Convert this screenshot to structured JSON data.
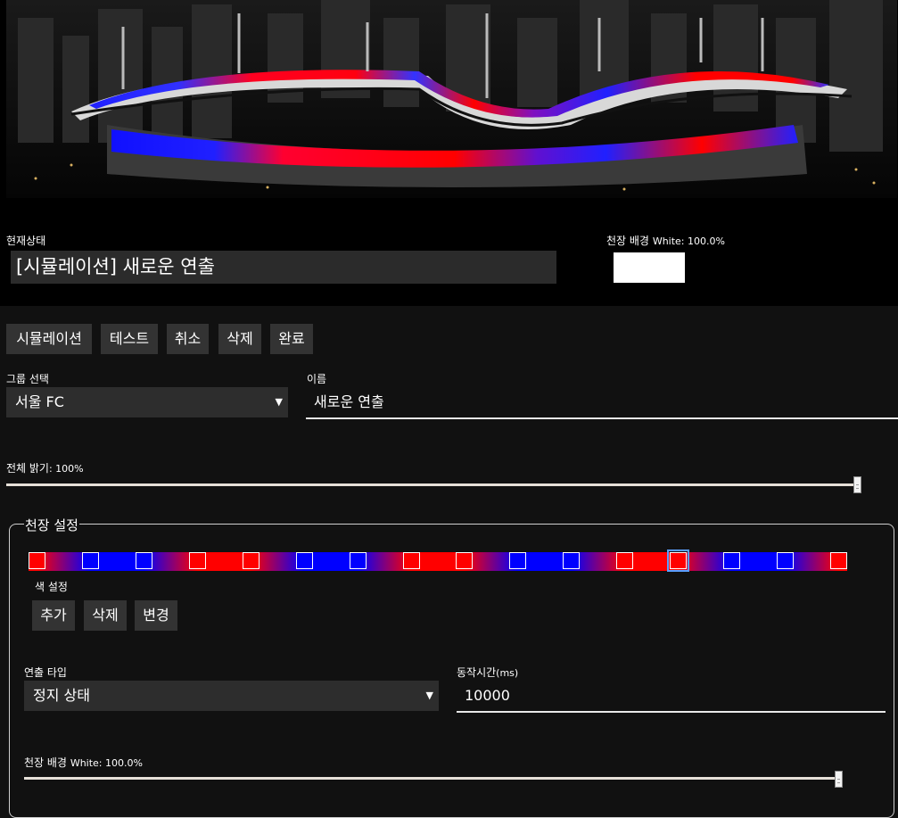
{
  "status": {
    "label": "현재상태",
    "value": "[시뮬레이션] 새로운 연출",
    "ceiling_label": "천장 배경",
    "ceiling_value": "White: 100.0%",
    "ceiling_color": "#ffffff"
  },
  "toolbar": {
    "simulate": "시뮬레이션",
    "test": "테스트",
    "cancel": "취소",
    "delete": "삭제",
    "done": "완료"
  },
  "group": {
    "label": "그룹 선택",
    "value": "서울 FC"
  },
  "name": {
    "label": "이름",
    "value": "새로운 연출"
  },
  "brightness": {
    "label": "전체 밝기",
    "value_text": ": 100%",
    "level": 1.0
  },
  "ceiling_settings": {
    "legend": "천장 설정",
    "stops": [
      "#ff0000",
      "#0000ff",
      "#0000ff",
      "#ff0000",
      "#ff0000",
      "#0000ff",
      "#0000ff",
      "#ff0000",
      "#ff0000",
      "#0000ff",
      "#0000ff",
      "#ff0000",
      "#ff0000",
      "#0000ff",
      "#0000ff",
      "#ff0000"
    ],
    "selected_stop": 12,
    "color_label": "색 설정",
    "add": "추가",
    "delete": "삭제",
    "change": "변경"
  },
  "effect": {
    "label": "연출 타입",
    "value": "정지 상태"
  },
  "duration": {
    "label": "동작시간",
    "unit": "(ms)",
    "value": "10000"
  },
  "ceiling_bg": {
    "label": "천장 배경",
    "value_text": "White: 100.0%",
    "level": 1.0
  }
}
